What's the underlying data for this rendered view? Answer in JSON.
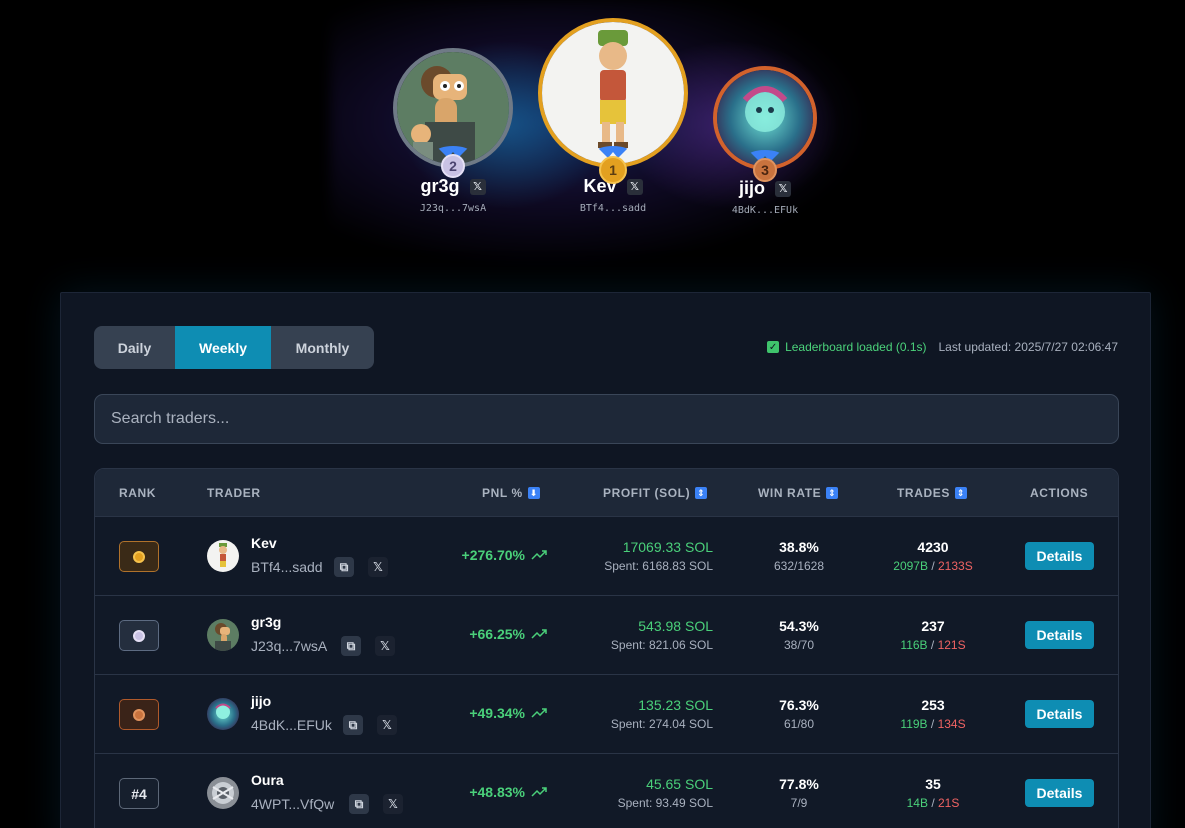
{
  "podium": [
    {
      "rank": "2",
      "name": "gr3g",
      "address": "J23q...7wsA",
      "x_label": "𝕏"
    },
    {
      "rank": "1",
      "name": "Kev",
      "address": "BTf4...sadd",
      "x_label": "𝕏"
    },
    {
      "rank": "3",
      "name": "jijo",
      "address": "4BdK...EFUk",
      "x_label": "𝕏"
    }
  ],
  "tabs": {
    "daily": "Daily",
    "weekly": "Weekly",
    "monthly": "Monthly",
    "active": "Weekly"
  },
  "status": {
    "loaded": "Leaderboard loaded (0.1s)",
    "updated": "Last updated: 2025/7/27 02:06:47"
  },
  "search": {
    "placeholder": "Search traders..."
  },
  "table": {
    "headers": {
      "rank": "RANK",
      "trader": "TRADER",
      "pnl": "PNL %",
      "profit": "PROFIT (SOL)",
      "winrate": "WIN RATE",
      "trades": "TRADES",
      "actions": "ACTIONS"
    },
    "rows": [
      {
        "rank": "1",
        "medal": "gold",
        "name": "Kev",
        "address": "BTf4...sadd",
        "pnl": "+276.70%",
        "profit": "17069.33 SOL",
        "spent": "Spent: 6168.83 SOL",
        "winrate": "38.8%",
        "winrate_detail": "632/1628",
        "trades": "4230",
        "buys": "2097B",
        "sells": "2133S",
        "action": "Details"
      },
      {
        "rank": "2",
        "medal": "silver",
        "name": "gr3g",
        "address": "J23q...7wsA",
        "pnl": "+66.25%",
        "profit": "543.98 SOL",
        "spent": "Spent: 821.06 SOL",
        "winrate": "54.3%",
        "winrate_detail": "38/70",
        "trades": "237",
        "buys": "116B",
        "sells": "121S",
        "action": "Details"
      },
      {
        "rank": "3",
        "medal": "bronze",
        "name": "jijo",
        "address": "4BdK...EFUk",
        "pnl": "+49.34%",
        "profit": "135.23 SOL",
        "spent": "Spent: 274.04 SOL",
        "winrate": "76.3%",
        "winrate_detail": "61/80",
        "trades": "253",
        "buys": "119B",
        "sells": "134S",
        "action": "Details"
      },
      {
        "rank": "#4",
        "medal": "none",
        "name": "Oura",
        "address": "4WPT...VfQw",
        "pnl": "+48.83%",
        "profit": "45.65 SOL",
        "spent": "Spent: 93.49 SOL",
        "winrate": "77.8%",
        "winrate_detail": "7/9",
        "trades": "35",
        "buys": "14B",
        "sells": "21S",
        "action": "Details"
      }
    ]
  },
  "colors": {
    "accent": "#0e8db3",
    "positive": "#4ad07a",
    "negative": "#f06363",
    "gold": "#e3a020",
    "silver": "#c9c2e4",
    "bronze": "#c9733e"
  },
  "icons": {
    "sort": "sort-icon",
    "trend": "trend-up-icon",
    "copy": "copy-icon",
    "x": "x-logo-icon",
    "check": "check-icon"
  }
}
